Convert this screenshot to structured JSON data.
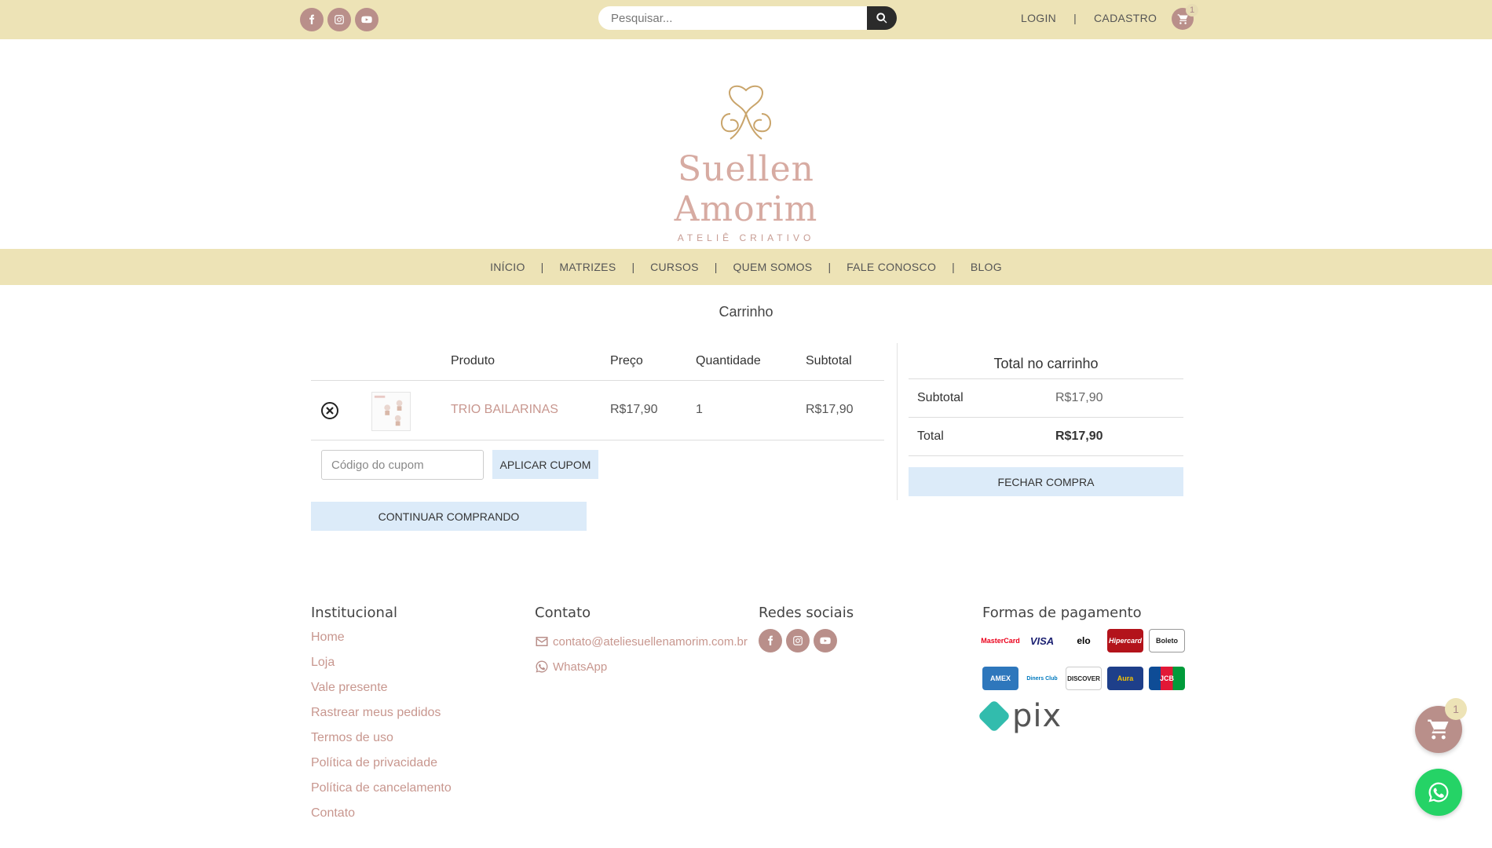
{
  "header": {
    "social": [
      "facebook-icon",
      "instagram-icon",
      "youtube-icon"
    ],
    "search_placeholder": "Pesquisar...",
    "login": "LOGIN",
    "separator": "|",
    "register": "CADASTRO",
    "cart_count": "1"
  },
  "logo": {
    "name": "Suellen Amorim",
    "tagline": "ATELIÊ CRIATIVO"
  },
  "nav": {
    "items": [
      "INÍCIO",
      "MATRIZES",
      "CURSOS",
      "QUEM SOMOS",
      "FALE CONOSCO",
      "BLOG"
    ],
    "separator": "|"
  },
  "page_title": "Carrinho",
  "cart": {
    "headers": {
      "product": "Produto",
      "price": "Preço",
      "quantity": "Quantidade",
      "subtotal": "Subtotal"
    },
    "items": [
      {
        "name": "TRIO BAILARINAS",
        "price": "R$17,90",
        "quantity": "1",
        "subtotal": "R$17,90"
      }
    ],
    "coupon_placeholder": "Código do cupom",
    "apply_label": "APLICAR CUPOM",
    "continue_label": "CONTINUAR COMPRANDO"
  },
  "totals": {
    "title": "Total no carrinho",
    "subtotal_label": "Subtotal",
    "subtotal_value": "R$17,90",
    "total_label": "Total",
    "total_value": "R$17,90",
    "checkout_label": "FECHAR COMPRA"
  },
  "footer": {
    "institutional": {
      "title": "Institucional",
      "links": [
        "Home",
        "Loja",
        "Vale presente",
        "Rastrear meus pedidos",
        "Termos de uso",
        "Política de privacidade",
        "Política de cancelamento",
        "Contato"
      ]
    },
    "contact": {
      "title": "Contato",
      "email": "contato@ateliesuellenamorim.com.br",
      "whatsapp": "WhatsApp"
    },
    "social": {
      "title": "Redes sociais"
    },
    "payments": {
      "title": "Formas de pagamento",
      "cards": [
        {
          "label": "MasterCard",
          "color": "#eb001b"
        },
        {
          "label": "VISA",
          "color": "#1a1f71"
        },
        {
          "label": "elo",
          "color": "#000000"
        },
        {
          "label": "Hipercard",
          "color": "#b3131b"
        },
        {
          "label": "Boleto",
          "color": "#ffffff"
        },
        {
          "label": "AMEX",
          "color": "#2e77bc"
        },
        {
          "label": "Diners Club",
          "color": "#0079be"
        },
        {
          "label": "DISCOVER",
          "color": "#ffffff"
        },
        {
          "label": "Aura",
          "color": "#1e3f8a"
        },
        {
          "label": "JCB",
          "color": "#0e4c96"
        }
      ],
      "pix": "pix"
    }
  },
  "floating": {
    "cart_count": "1"
  }
}
